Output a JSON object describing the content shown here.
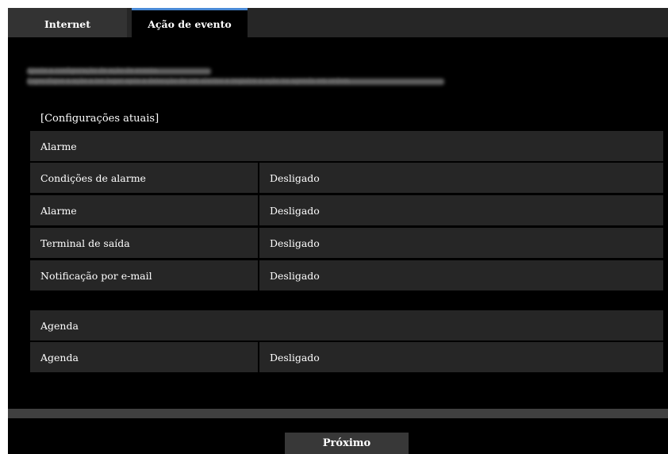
{
  "tabs": [
    {
      "label": "Internet",
      "active": false
    },
    {
      "label": "Ação de evento",
      "active": true
    }
  ],
  "intro": {
    "line1": "Ajuste a configuração de ação de evento.",
    "line2": "Especifique a ação a ter lugar após a detecção de um alarme e registre a ação na agenda em ordem."
  },
  "current_settings": {
    "heading": "[Configurações atuais]"
  },
  "alarm_section": {
    "title": "Alarme",
    "rows": [
      {
        "label": "Condições de alarme",
        "value": "Desligado"
      },
      {
        "label": "Alarme",
        "value": "Desligado"
      },
      {
        "label": "Terminal de saída",
        "value": "Desligado"
      },
      {
        "label": "Notificação por e-mail",
        "value": "Desligado"
      }
    ]
  },
  "schedule_section": {
    "title": "Agenda",
    "rows": [
      {
        "label": "Agenda",
        "value": "Desligado"
      }
    ]
  },
  "footer": {
    "next_label": "Próximo"
  },
  "colors": {
    "background": "#000000",
    "row_background": "#262626",
    "active_tab_accent": "#4a8ad6",
    "text": "#ffffff"
  }
}
